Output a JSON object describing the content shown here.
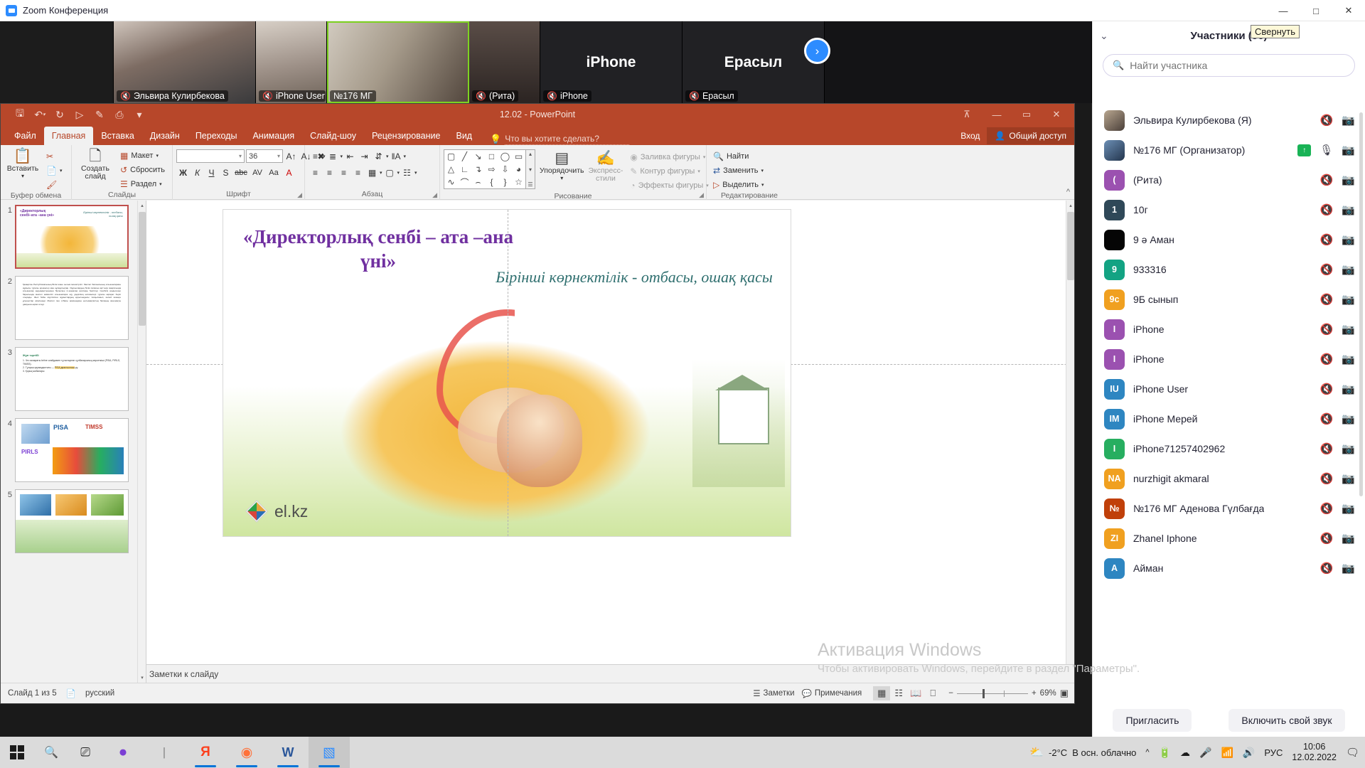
{
  "zoom_window": {
    "title": "Zoom Конференция",
    "window_controls": {
      "minimize": "—",
      "maximize": "□",
      "close": "✕"
    },
    "video_tiles": [
      {
        "name": "Эльвира Кулирбекова",
        "muted": true,
        "kind": "video",
        "bg": "#6b5a52"
      },
      {
        "name": "iPhone User",
        "muted": true,
        "kind": "video",
        "bg": "#8f8279"
      },
      {
        "name": "№176 МГ",
        "muted": false,
        "kind": "video",
        "bg": "#9a8f80",
        "active": true
      },
      {
        "name": "(Рита)",
        "muted": true,
        "kind": "video",
        "bg": "#5a4b46"
      },
      {
        "name": "iPhone",
        "muted": true,
        "kind": "placeholder",
        "big_label": "iPhone"
      },
      {
        "name": "Ерасыл",
        "muted": true,
        "kind": "placeholder",
        "big_label": "Ерасыл"
      }
    ],
    "next_arrow_icon": "›"
  },
  "participants": {
    "header_title": "Участники (56)",
    "collapse_tooltip": "Свернуть",
    "chevron_icon": "⌄",
    "search": {
      "placeholder": "Найти участника",
      "icon": "search-icon",
      "value": ""
    },
    "items": [
      {
        "name": "Эльвира Кулирбекова (Я)",
        "initials": "",
        "color": "#6f6a5e",
        "photo": true,
        "mic": "muted",
        "cam": "off",
        "raised": false
      },
      {
        "name": "№176 МГ (Организатор)",
        "initials": "",
        "color": "#3d5a80",
        "photo": true,
        "mic": "on",
        "cam": "on",
        "raised": true
      },
      {
        "name": "(Рита)",
        "initials": "(",
        "color": "#9b51b0",
        "photo": false,
        "mic": "muted",
        "cam": "on",
        "raised": false
      },
      {
        "name": "10г",
        "initials": "1",
        "color": "#2f4858",
        "photo": false,
        "mic": "muted",
        "cam": "off",
        "raised": false
      },
      {
        "name": "9 ә Аман",
        "initials": "",
        "color": "#050505",
        "photo": false,
        "mic": "muted",
        "cam": "off",
        "raised": false
      },
      {
        "name": "933316",
        "initials": "9",
        "color": "#13a383",
        "photo": false,
        "mic": "muted",
        "cam": "off",
        "raised": false
      },
      {
        "name": "9Б сынып",
        "initials": "9с",
        "color": "#f0a020",
        "photo": false,
        "mic": "muted",
        "cam": "off",
        "raised": false
      },
      {
        "name": "iPhone",
        "initials": "I",
        "color": "#9b51b0",
        "photo": false,
        "mic": "muted",
        "cam": "off",
        "raised": false
      },
      {
        "name": "iPhone",
        "initials": "I",
        "color": "#9b51b0",
        "photo": false,
        "mic": "muted",
        "cam": "off",
        "raised": false
      },
      {
        "name": "iPhone User",
        "initials": "IU",
        "color": "#2e86c1",
        "photo": false,
        "mic": "muted",
        "cam": "on",
        "raised": false
      },
      {
        "name": "iPhone Мерей",
        "initials": "IM",
        "color": "#2e86c1",
        "photo": false,
        "mic": "muted",
        "cam": "off",
        "raised": false
      },
      {
        "name": "iPhone71257402962",
        "initials": "I",
        "color": "#27ae60",
        "photo": false,
        "mic": "muted",
        "cam": "off",
        "raised": false
      },
      {
        "name": "nurzhigit akmaral",
        "initials": "NA",
        "color": "#f0a020",
        "photo": false,
        "mic": "muted",
        "cam": "off",
        "raised": false
      },
      {
        "name": "№176 МГ Аденова Гүлбағда",
        "initials": "№",
        "color": "#c0400a",
        "photo": false,
        "mic": "muted",
        "cam": "off",
        "raised": false
      },
      {
        "name": "Zhanel Iphone",
        "initials": "ZI",
        "color": "#f0a020",
        "photo": false,
        "mic": "muted",
        "cam": "off",
        "raised": false
      },
      {
        "name": "Айман",
        "initials": "A",
        "color": "#2e86c1",
        "photo": false,
        "mic": "muted",
        "cam": "off",
        "raised": false
      }
    ],
    "footer": {
      "invite": "Пригласить",
      "unmute": "Включить свой звук"
    }
  },
  "powerpoint": {
    "doc_title": "12.02 - PowerPoint",
    "quick_access": [
      "save-icon",
      "undo-icon",
      "redo-icon",
      "start-slideshow-icon",
      "touch-mode-icon",
      "preview-icon",
      "customize-qat-icon"
    ],
    "window_controls": {
      "ribbon_display": "⊼",
      "minimize": "—",
      "restore": "▭",
      "close": "✕"
    },
    "tabs": [
      "Файл",
      "Главная",
      "Вставка",
      "Дизайн",
      "Переходы",
      "Анимация",
      "Слайд-шоу",
      "Рецензирование",
      "Вид"
    ],
    "active_tab": "Главная",
    "tell_me": "Что вы хотите сделать?",
    "sign_in": "Вход",
    "share": "Общий доступ",
    "ribbon": {
      "groups": [
        {
          "label": "Буфер обмена",
          "big": {
            "label": "Вставить",
            "icon": "paste-icon"
          },
          "small": [
            {
              "label": "",
              "icon": "cut-icon"
            },
            {
              "label": "",
              "icon": "copy-icon"
            },
            {
              "label": "",
              "icon": "format-painter-icon"
            }
          ]
        },
        {
          "label": "Слайды",
          "big": {
            "label": "Создать слайд",
            "icon": "new-slide-icon"
          },
          "small": [
            {
              "label": "Макет",
              "icon": "layout-icon"
            },
            {
              "label": "Сбросить",
              "icon": "reset-icon"
            },
            {
              "label": "Раздел",
              "icon": "section-icon"
            }
          ]
        },
        {
          "label": "Шрифт",
          "font_name": "",
          "font_size": "36"
        },
        {
          "label": "Абзац"
        },
        {
          "label": "Рисование",
          "items": [
            {
              "label": "Упорядочить",
              "icon": "arrange-icon"
            },
            {
              "label": "Экспресс-стили",
              "icon": "quick-styles-icon"
            },
            {
              "label": "Заливка фигуры",
              "icon": "shape-fill-icon"
            },
            {
              "label": "Контур фигуры",
              "icon": "shape-outline-icon"
            },
            {
              "label": "Эффекты фигуры",
              "icon": "shape-effects-icon"
            }
          ]
        },
        {
          "label": "Редактирование",
          "items": [
            {
              "label": "Найти",
              "icon": "find-icon"
            },
            {
              "label": "Заменить",
              "icon": "replace-icon"
            },
            {
              "label": "Выделить",
              "icon": "select-icon"
            }
          ]
        }
      ]
    },
    "slide": {
      "title": "«Директорлық  сенбі – ата –ана үні»",
      "subtitle": "Бірінші көрнектілік - отбасы, ошақ қасы",
      "logo_text": "el.kz"
    },
    "thumbnails": [
      {
        "number": "1",
        "selected": true
      },
      {
        "number": "2",
        "selected": false
      },
      {
        "number": "3",
        "selected": false
      },
      {
        "number": "4",
        "selected": false
      },
      {
        "number": "5",
        "selected": false
      }
    ],
    "notes_placeholder": "Заметки к слайду",
    "status": {
      "slide_counter": "Слайд 1 из 5",
      "language": "русский",
      "notes_button": "Заметки",
      "comments_button": "Примечания",
      "zoom_level": "69%",
      "zoom_minus": "−",
      "zoom_plus": "+",
      "views": [
        "normal-view-icon",
        "slide-sorter-icon",
        "reading-view-icon",
        "slideshow-icon"
      ]
    }
  },
  "watermark": {
    "line1": "Активация Windows",
    "line2": "Чтобы активировать Windows, перейдите в раздел \"Параметры\"."
  },
  "taskbar": {
    "start_icon": "windows-logo-icon",
    "search_icon": "search-icon",
    "taskview_icon": "task-view-icon",
    "apps": [
      {
        "name": "cortana-icon",
        "glyph": "●",
        "color": "#7b3fd4"
      },
      {
        "name": "separator",
        "glyph": "|",
        "color": "#555"
      },
      {
        "name": "yandex-browser-icon",
        "glyph": "Я",
        "color": "#fc3f1d"
      },
      {
        "name": "firefox-icon",
        "glyph": "◉",
        "color": "#ff7139"
      },
      {
        "name": "word-icon",
        "glyph": "W",
        "color": "#2b579a"
      },
      {
        "name": "zoom-icon",
        "glyph": "▣",
        "color": "#2d8cff"
      }
    ],
    "weather": {
      "temp": "-2°C",
      "text": "В осн. облачно",
      "icon": "cloudy-icon"
    },
    "tray_icons": [
      "show-hidden-icons",
      "battery-icon",
      "onedrive-icon",
      "microphone-icon",
      "wifi-icon",
      "volume-icon"
    ],
    "language": "РУС",
    "time": "10:06",
    "date": "12.02.2022",
    "notifications_icon": "notification-icon"
  }
}
